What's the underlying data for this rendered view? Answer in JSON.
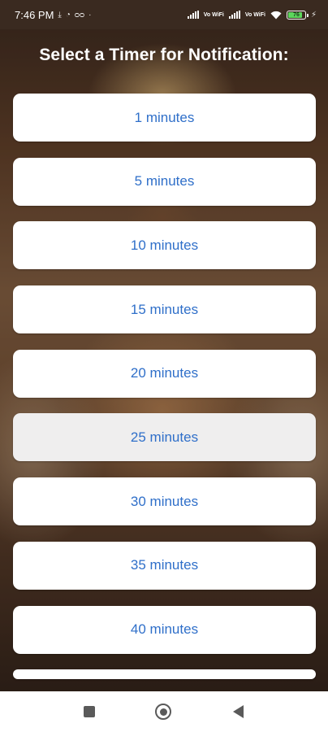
{
  "status_bar": {
    "time": "7:46 PM",
    "battery_level": "76",
    "icons": [
      "download-icon",
      "whatsapp-icon",
      "voicemail-icon",
      "dot-icon",
      "signal-icon",
      "vowifi-icon",
      "signal-icon",
      "vowifi-icon",
      "wifi-icon",
      "battery-icon",
      "charging-icon"
    ],
    "vowifi_label": "Vo WiFi"
  },
  "page": {
    "title": "Select a Timer for Notification:"
  },
  "timers": [
    {
      "label": "1 minutes"
    },
    {
      "label": "5 minutes"
    },
    {
      "label": "10 minutes"
    },
    {
      "label": "15 minutes"
    },
    {
      "label": "20 minutes"
    },
    {
      "label": "25 minutes",
      "state": "pressed"
    },
    {
      "label": "30 minutes"
    },
    {
      "label": "35 minutes"
    },
    {
      "label": "40 minutes"
    }
  ],
  "nav_bar": {
    "buttons": [
      "recents-icon",
      "home-icon",
      "back-icon"
    ]
  },
  "colors": {
    "button_text": "#2f6fc9",
    "button_bg": "#ffffff",
    "button_pressed_bg": "#efeeee",
    "title_text": "#ffffff",
    "status_bar_bg": "#3a2a20",
    "battery_fill": "#5cd65c"
  }
}
